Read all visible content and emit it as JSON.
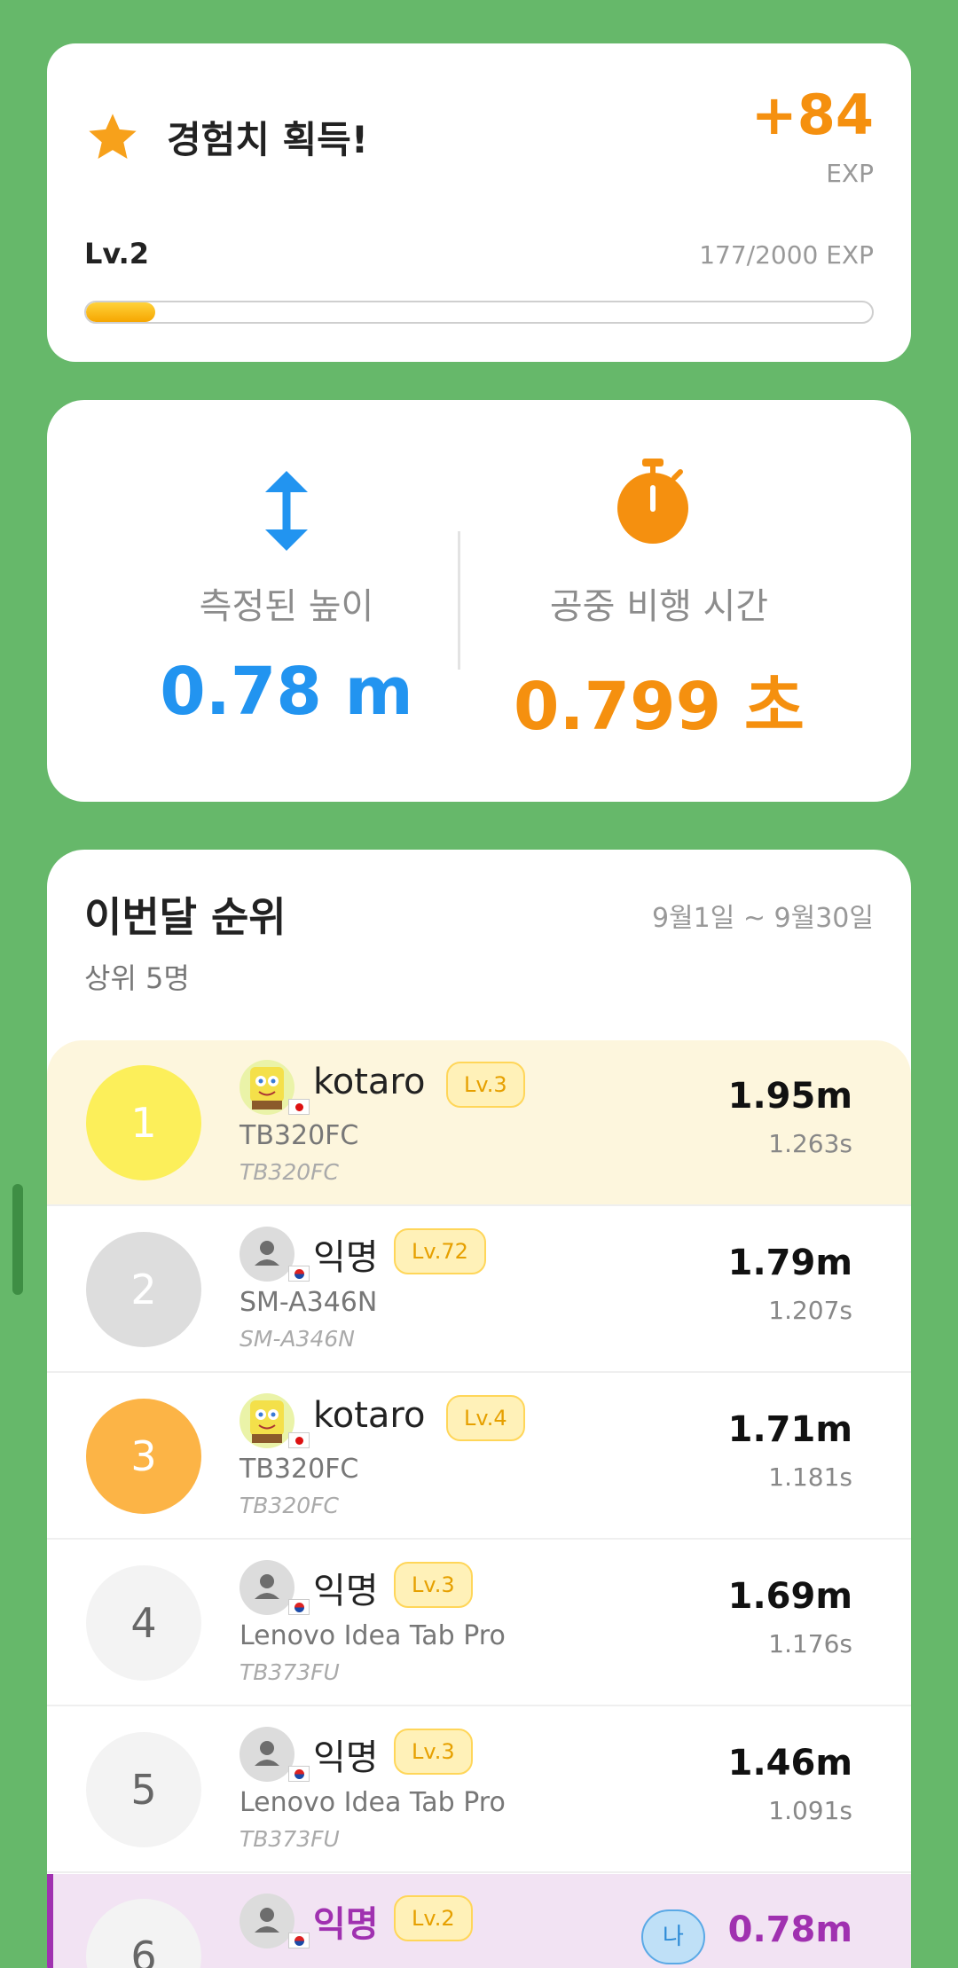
{
  "exp_card": {
    "title": "경험치 획득!",
    "gain": "+84",
    "unit": "EXP",
    "level": "Lv.2",
    "progress_text": "177/2000 EXP",
    "progress_fraction": 0.0885,
    "icon": "star-icon"
  },
  "measure_card": {
    "height_label": "측정된 높이",
    "height_value": "0.78 m",
    "airtime_label": "공중 비행 시간",
    "airtime_value": "0.799 초",
    "height_icon": "vertical-arrows-icon",
    "airtime_icon": "stopwatch-icon"
  },
  "ranking": {
    "title": "이번달 순위",
    "period": "9월1일 ~ 9월30일",
    "subtitle": "상위 5명",
    "me_badge": "나",
    "rows": [
      {
        "rank": "1",
        "name": "kotaro",
        "level": "Lv.3",
        "device": "TB320FC",
        "model": "TB320FC",
        "distance": "1.95m",
        "time": "1.263s",
        "flag": "JP",
        "avatar": "sponge-avatar"
      },
      {
        "rank": "2",
        "name": "익명",
        "level": "Lv.72",
        "device": "SM-A346N",
        "model": "SM-A346N",
        "distance": "1.79m",
        "time": "1.207s",
        "flag": "KR",
        "avatar": "person-avatar"
      },
      {
        "rank": "3",
        "name": "kotaro",
        "level": "Lv.4",
        "device": "TB320FC",
        "model": "TB320FC",
        "distance": "1.71m",
        "time": "1.181s",
        "flag": "JP",
        "avatar": "sponge-avatar"
      },
      {
        "rank": "4",
        "name": "익명",
        "level": "Lv.3",
        "device": "Lenovo Idea Tab Pro",
        "model": "TB373FU",
        "distance": "1.69m",
        "time": "1.176s",
        "flag": "KR",
        "avatar": "person-avatar"
      },
      {
        "rank": "5",
        "name": "익명",
        "level": "Lv.3",
        "device": "Lenovo Idea Tab Pro",
        "model": "TB373FU",
        "distance": "1.46m",
        "time": "1.091s",
        "flag": "KR",
        "avatar": "person-avatar"
      },
      {
        "rank": "6",
        "name": "익명",
        "level": "Lv.2",
        "distance": "0.78m",
        "flag": "KR",
        "avatar": "person-avatar",
        "is_me": true
      }
    ]
  },
  "colors": {
    "background": "#66b86a",
    "accent_orange": "#f5900f",
    "accent_blue": "#2294f0",
    "me_purple": "#a031b0",
    "gold": "#fcef5a",
    "silver": "#dddddd",
    "bronze": "#fcb446"
  }
}
